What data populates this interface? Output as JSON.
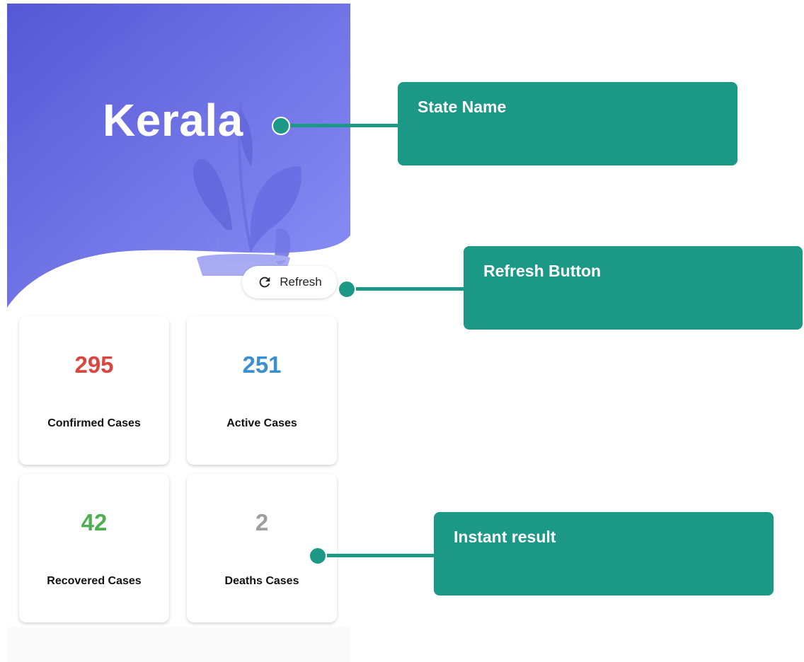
{
  "app": {
    "state_name": "Kerala",
    "refresh_label": "Refresh",
    "header_gradient": [
      "#5a5fd6",
      "#8a8ef5"
    ]
  },
  "cards": [
    {
      "value": "295",
      "label": "Confirmed Cases",
      "color": "#d9473f"
    },
    {
      "value": "251",
      "label": "Active Cases",
      "color": "#3a8fd0"
    },
    {
      "value": "42",
      "label": "Recovered Cases",
      "color": "#4caf50"
    },
    {
      "value": "2",
      "label": "Deaths Cases",
      "color": "#9e9e9e"
    }
  ],
  "annotations": {
    "state_name": "State Name",
    "refresh_button": "Refresh Button",
    "instant_result": "Instant result",
    "color": "#1c9986"
  },
  "icons": {
    "refresh": "refresh-icon",
    "plant": "plant-illustration"
  }
}
